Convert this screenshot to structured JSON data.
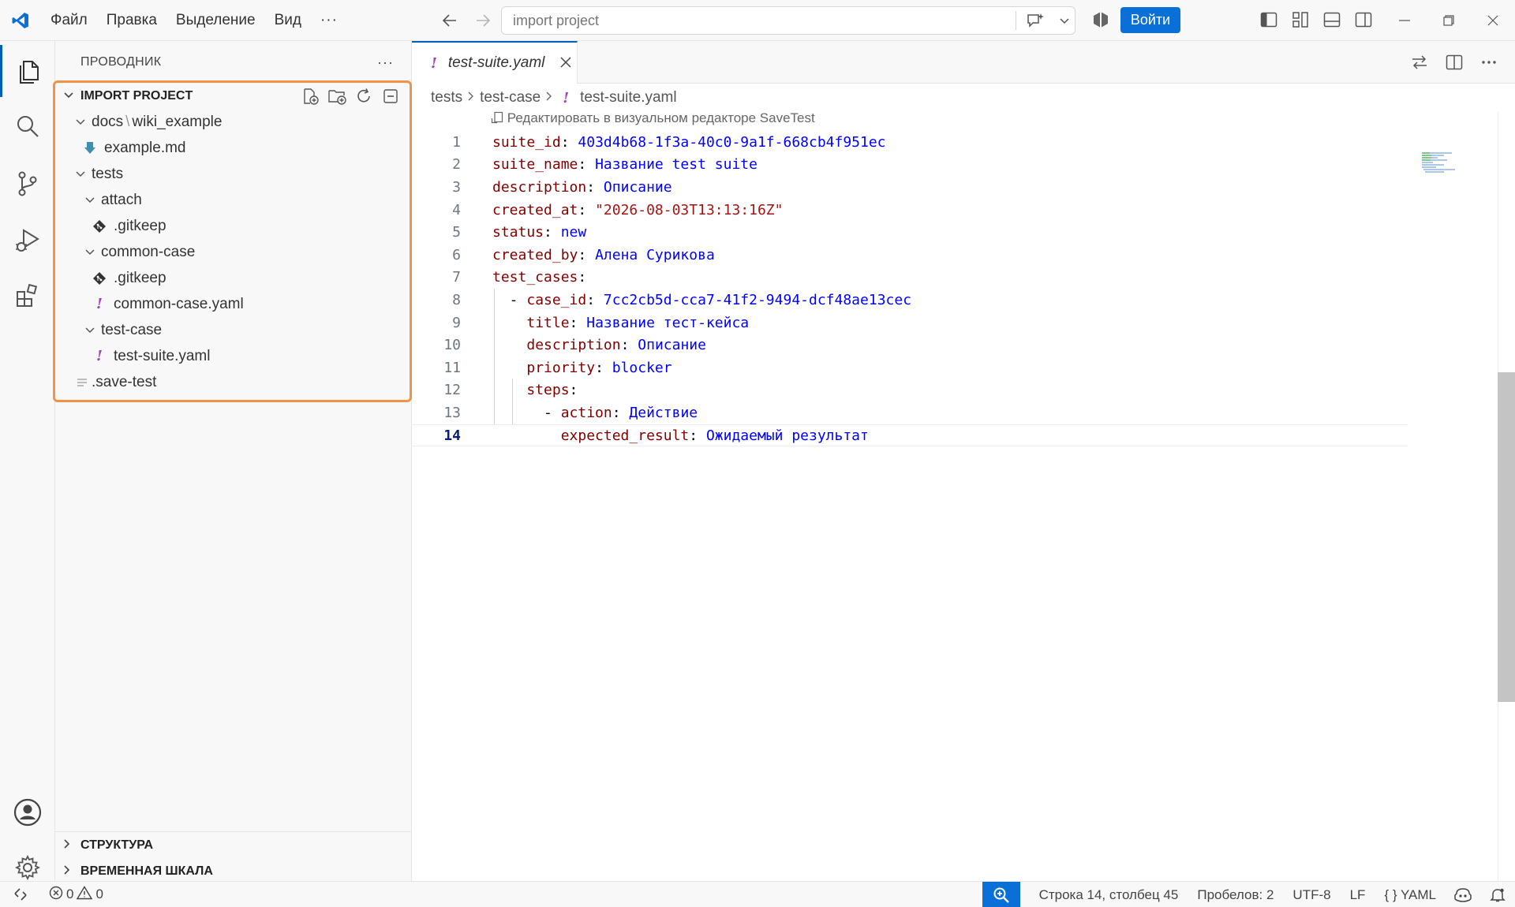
{
  "titlebar": {
    "menu": [
      "Файл",
      "Правка",
      "Выделение",
      "Вид"
    ],
    "menu_more": "···",
    "search_text": "import project",
    "login_label": "Войти"
  },
  "sidebar": {
    "title": "ПРОВОДНИК",
    "more": "···",
    "project_title": "IMPORT PROJECT",
    "tree": [
      {
        "name_a": "docs",
        "name_b": "wiki_example",
        "sep": "\\"
      },
      {
        "name": "example.md"
      },
      {
        "name": "tests"
      },
      {
        "name": "attach"
      },
      {
        "name": ".gitkeep"
      },
      {
        "name": "common-case"
      },
      {
        "name": ".gitkeep"
      },
      {
        "name": "common-case.yaml"
      },
      {
        "name": "test-case"
      },
      {
        "name": "test-suite.yaml"
      },
      {
        "name": ".save-test"
      }
    ],
    "outline_label": "СТРУКТУРА",
    "timeline_label": "ВРЕМЕННАЯ ШКАЛА"
  },
  "editor": {
    "tab_label": "test-suite.yaml",
    "breadcrumbs": [
      "tests",
      "test-case",
      "test-suite.yaml"
    ],
    "codelens": "Редактировать в визуальном редакторе SaveTest",
    "lines": [
      {
        "n": "1",
        "key": "suite_id",
        "val": "403d4b68-1f3a-40c0-9a1f-668cb4f951ec"
      },
      {
        "n": "2",
        "key": "suite_name",
        "val": "Название test suite"
      },
      {
        "n": "3",
        "key": "description",
        "val": "Описание"
      },
      {
        "n": "4",
        "key": "created_at",
        "val": "\"2026-08-03T13:13:16Z\""
      },
      {
        "n": "5",
        "key": "status",
        "val": "new"
      },
      {
        "n": "6",
        "key": "created_by",
        "val": "Алена Сурикова"
      },
      {
        "n": "7",
        "key": "test_cases",
        "val": ""
      },
      {
        "n": "8",
        "key": "case_id",
        "val": "7cc2cb5d-cca7-41f2-9494-dcf48ae13cec"
      },
      {
        "n": "9",
        "key": "title",
        "val": "Название тест-кейса"
      },
      {
        "n": "10",
        "key": "description",
        "val": "Описание"
      },
      {
        "n": "11",
        "key": "priority",
        "val": "blocker"
      },
      {
        "n": "12",
        "key": "steps",
        "val": ""
      },
      {
        "n": "13",
        "key": "action",
        "val": "Действие"
      },
      {
        "n": "14",
        "key": "expected_result",
        "val": "Ожидаемый результат"
      }
    ]
  },
  "statusbar": {
    "errors": "0",
    "warnings": "0",
    "position": "Строка 14, столбец 45",
    "spaces": "Пробелов: 2",
    "encoding": "UTF-8",
    "eol": "LF",
    "language_braces": "{ }",
    "language": "YAML"
  },
  "colors": {
    "accent": "#005fb8",
    "login_button": "#0a6fd6",
    "highlight_box": "#f0944c",
    "yaml_key": "#800000",
    "yaml_value": "#0000ff",
    "yaml_string": "#a31515"
  }
}
